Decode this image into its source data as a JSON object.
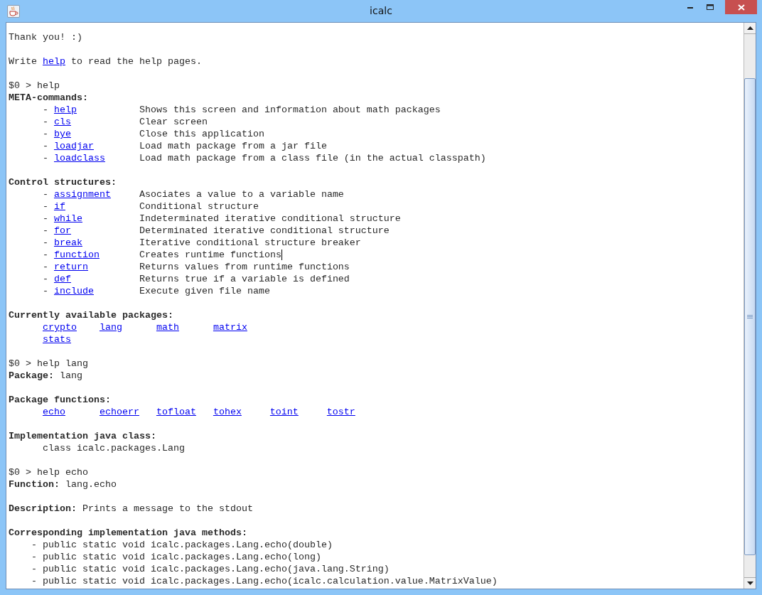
{
  "window": {
    "title": "icalc"
  },
  "lines": [
    {
      "kind": "text",
      "text": "Thank you! :)"
    },
    {
      "kind": "blank"
    },
    {
      "kind": "link_text",
      "before": "Write",
      "link": "help",
      "after": "to read the help pages."
    },
    {
      "kind": "blank"
    },
    {
      "kind": "text",
      "text": "$0 > help"
    },
    {
      "kind": "heading",
      "label": "META-commands:"
    },
    {
      "kind": "entry",
      "dash": "-",
      "link": "help",
      "description": "Shows this screen and information about math packages",
      "cursor": false
    },
    {
      "kind": "entry",
      "dash": "-",
      "link": "cls",
      "description": "Clear screen",
      "cursor": false
    },
    {
      "kind": "entry",
      "dash": "-",
      "link": "bye",
      "description": "Close this application",
      "cursor": false
    },
    {
      "kind": "entry",
      "dash": "-",
      "link": "loadjar",
      "description": "Load math package from a jar file",
      "cursor": false
    },
    {
      "kind": "entry",
      "dash": "-",
      "link": "loadclass",
      "description": "Load math package from a class file (in the actual classpath)",
      "cursor": false
    },
    {
      "kind": "blank"
    },
    {
      "kind": "heading",
      "label": "Control structures:"
    },
    {
      "kind": "entry",
      "dash": "-",
      "link": "assignment",
      "description": "Asociates a value to a variable name",
      "cursor": false
    },
    {
      "kind": "entry",
      "dash": "-",
      "link": "if",
      "description": "Conditional structure",
      "cursor": false
    },
    {
      "kind": "entry",
      "dash": "-",
      "link": "while",
      "description": "Indeterminated iterative conditional structure",
      "cursor": false
    },
    {
      "kind": "entry",
      "dash": "-",
      "link": "for",
      "description": "Determinated iterative conditional structure",
      "cursor": false
    },
    {
      "kind": "entry",
      "dash": "-",
      "link": "break",
      "description": "Iterative conditional structure breaker",
      "cursor": false
    },
    {
      "kind": "entry",
      "dash": "-",
      "link": "function",
      "description": "Creates runtime functions",
      "cursor": true
    },
    {
      "kind": "entry",
      "dash": "-",
      "link": "return",
      "description": "Returns values from runtime functions",
      "cursor": false
    },
    {
      "kind": "entry",
      "dash": "-",
      "link": "def",
      "description": "Returns true if a variable is defined",
      "cursor": false
    },
    {
      "kind": "entry",
      "dash": "-",
      "link": "include",
      "description": "Execute given file name",
      "cursor": false
    },
    {
      "kind": "blank"
    },
    {
      "kind": "heading",
      "label": "Currently available packages:"
    },
    {
      "kind": "links",
      "links": [
        "crypto",
        "lang",
        "math",
        "matrix"
      ]
    },
    {
      "kind": "links",
      "links": [
        "stats"
      ]
    },
    {
      "kind": "blank"
    },
    {
      "kind": "text",
      "text": "$0 > help lang"
    },
    {
      "kind": "field",
      "label": "Package:",
      "value": "lang"
    },
    {
      "kind": "blank"
    },
    {
      "kind": "heading",
      "label": "Package functions:"
    },
    {
      "kind": "links",
      "links": [
        "echo",
        "echoerr",
        "tofloat",
        "tohex",
        "toint",
        "tostr"
      ]
    },
    {
      "kind": "blank"
    },
    {
      "kind": "heading",
      "label": "Implementation java class:"
    },
    {
      "kind": "indented",
      "text": "class icalc.packages.Lang"
    },
    {
      "kind": "blank"
    },
    {
      "kind": "text",
      "text": "$0 > help echo"
    },
    {
      "kind": "field",
      "label": "Function:",
      "value": "lang.echo"
    },
    {
      "kind": "blank"
    },
    {
      "kind": "field",
      "label": "Description:",
      "value": "Prints a message to the stdout"
    },
    {
      "kind": "blank"
    },
    {
      "kind": "heading",
      "label": "Corresponding implementation java methods:"
    },
    {
      "kind": "method",
      "dash": "-",
      "text": "public static void icalc.packages.Lang.echo(double)"
    },
    {
      "kind": "method",
      "dash": "-",
      "text": "public static void icalc.packages.Lang.echo(long)"
    },
    {
      "kind": "method",
      "dash": "-",
      "text": "public static void icalc.packages.Lang.echo(java.lang.String)"
    },
    {
      "kind": "method",
      "dash": "-",
      "text": "public static void icalc.packages.Lang.echo(icalc.calculation.value.MatrixValue)"
    }
  ]
}
